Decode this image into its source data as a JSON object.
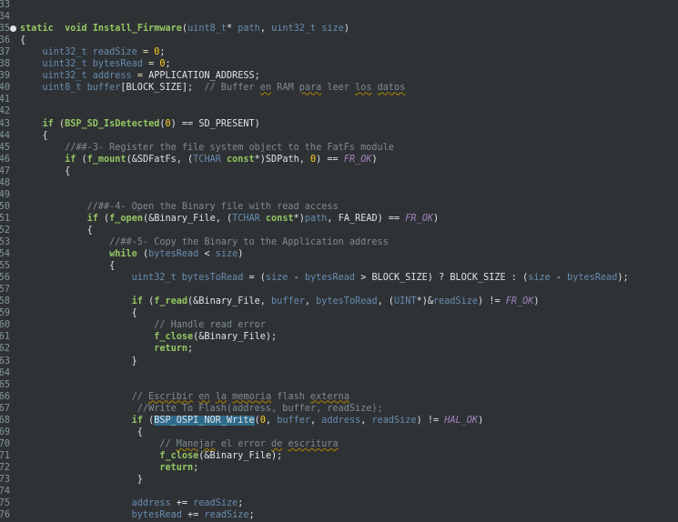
{
  "editor": {
    "lines": [
      {
        "n": "33",
        "segs": []
      },
      {
        "n": "34",
        "segs": []
      },
      {
        "n": "35",
        "bp": true,
        "segs": [
          [
            "kw",
            "static"
          ],
          [
            "",
            "  "
          ],
          [
            "kw",
            "void"
          ],
          [
            "",
            ""
          ],
          [
            "fndef",
            " Install_Firmware"
          ],
          [
            "",
            "("
          ],
          [
            "ty",
            "uint8_t"
          ],
          [
            "",
            "* "
          ],
          [
            "ty",
            "path"
          ],
          [
            "",
            ", "
          ],
          [
            "ty",
            "uint32_t"
          ],
          [
            "",
            ""
          ],
          [
            "ty",
            " size"
          ],
          [
            "",
            ")"
          ]
        ]
      },
      {
        "n": "36",
        "segs": [
          [
            "",
            "{"
          ]
        ]
      },
      {
        "n": "37",
        "segs": [
          [
            "",
            ""
          ],
          [
            "ty",
            "    uint32_t"
          ],
          [
            "ty",
            " readSize"
          ],
          [
            "op",
            " = "
          ],
          [
            "num",
            "0"
          ],
          [
            "",
            ";"
          ]
        ]
      },
      {
        "n": "38",
        "segs": [
          [
            "ty",
            "    uint32_t"
          ],
          [
            "ty",
            " bytesRead"
          ],
          [
            "op",
            " = "
          ],
          [
            "num",
            "0"
          ],
          [
            "",
            ";"
          ]
        ]
      },
      {
        "n": "39",
        "segs": [
          [
            "ty",
            "    uint32_t"
          ],
          [
            "ty",
            " address"
          ],
          [
            "op",
            " = "
          ],
          [
            "",
            "APPLICATION_ADDRESS;"
          ]
        ]
      },
      {
        "n": "40",
        "segs": [
          [
            "ty",
            "    uint8_t"
          ],
          [
            "ty",
            " buffer"
          ],
          [
            "",
            "[BLOCK_SIZE];  "
          ],
          [
            "cm",
            "// Buffer "
          ],
          [
            "sq",
            "en"
          ],
          [
            "cm",
            " RAM "
          ],
          [
            "sq",
            "para"
          ],
          [
            "cm",
            " leer "
          ],
          [
            "sq",
            "los"
          ],
          [
            "cm",
            " "
          ],
          [
            "sq",
            "datos"
          ]
        ]
      },
      {
        "n": "41",
        "segs": []
      },
      {
        "n": "42",
        "segs": []
      },
      {
        "n": "43",
        "segs": [
          [
            "kw",
            "    if"
          ],
          [
            "",
            ""
          ],
          [
            "op",
            " ("
          ],
          [
            "fn",
            "BSP_SD_IsDetected"
          ],
          [
            "",
            "("
          ],
          [
            "num",
            "0"
          ],
          [
            "",
            ") == SD_PRESENT)"
          ]
        ]
      },
      {
        "n": "44",
        "segs": [
          [
            "",
            "    {"
          ]
        ]
      },
      {
        "n": "45",
        "segs": [
          [
            "cm",
            "        //##-3- Register the file system object to the FatFs module"
          ]
        ]
      },
      {
        "n": "46",
        "segs": [
          [
            "kw",
            "        if"
          ],
          [
            "",
            " ("
          ],
          [
            "fn",
            "f_mount"
          ],
          [
            "",
            "(&SDFatFs, ("
          ],
          [
            "ty",
            "TCHAR"
          ],
          [
            "kw",
            " const"
          ],
          [
            "",
            "*)SDPath, "
          ],
          [
            "num",
            "0"
          ],
          [
            "",
            ") == "
          ],
          [
            "it",
            "FR_OK"
          ],
          [
            "",
            ")"
          ]
        ]
      },
      {
        "n": "47",
        "segs": [
          [
            "",
            "        {"
          ]
        ]
      },
      {
        "n": "48",
        "segs": []
      },
      {
        "n": "49",
        "segs": []
      },
      {
        "n": "50",
        "segs": [
          [
            "cm",
            "            //##-4- Open the Binary file with read access"
          ]
        ]
      },
      {
        "n": "51",
        "segs": [
          [
            "kw",
            "            if"
          ],
          [
            "",
            " ("
          ],
          [
            "fn",
            "f_open"
          ],
          [
            "",
            "(&Binary_File, ("
          ],
          [
            "ty",
            "TCHAR"
          ],
          [
            "kw",
            " const"
          ],
          [
            "",
            "*)"
          ],
          [
            "ty",
            "path"
          ],
          [
            "",
            ", FA_READ) == "
          ],
          [
            "it",
            "FR_OK"
          ],
          [
            "",
            ")"
          ]
        ]
      },
      {
        "n": "52",
        "segs": [
          [
            "",
            "            {"
          ]
        ]
      },
      {
        "n": "53",
        "segs": [
          [
            "cm",
            "                //##-5- Copy the Binary to the Application address"
          ]
        ]
      },
      {
        "n": "54",
        "segs": [
          [
            "kw",
            "                while"
          ],
          [
            "",
            " ("
          ],
          [
            "ty",
            "bytesRead"
          ],
          [
            "",
            " < "
          ],
          [
            "ty",
            "size"
          ],
          [
            "",
            ")"
          ]
        ]
      },
      {
        "n": "55",
        "segs": [
          [
            "",
            "                {"
          ]
        ]
      },
      {
        "n": "56",
        "segs": [
          [
            "ty",
            "                    uint32_t"
          ],
          [
            "ty",
            " bytesToRead"
          ],
          [
            "",
            " = ("
          ],
          [
            "ty",
            "size"
          ],
          [
            "",
            " - "
          ],
          [
            "ty",
            "bytesRead"
          ],
          [
            "",
            " > BLOCK_SIZE) ? BLOCK_SIZE : ("
          ],
          [
            "ty",
            "size"
          ],
          [
            "",
            " - "
          ],
          [
            "ty",
            "bytesRead"
          ],
          [
            "",
            ");"
          ]
        ]
      },
      {
        "n": "57",
        "segs": []
      },
      {
        "n": "58",
        "segs": [
          [
            "kw",
            "                    if"
          ],
          [
            "",
            " ("
          ],
          [
            "fn",
            "f_read"
          ],
          [
            "",
            "(&Binary_File, "
          ],
          [
            "ty",
            "buffer"
          ],
          [
            "",
            ", "
          ],
          [
            "ty",
            "bytesToRead"
          ],
          [
            "",
            ", ("
          ],
          [
            "ty",
            "UINT"
          ],
          [
            "",
            "*)&"
          ],
          [
            "ty",
            "readSize"
          ],
          [
            "",
            ") != "
          ],
          [
            "it",
            "FR_OK"
          ],
          [
            "",
            ")"
          ]
        ]
      },
      {
        "n": "59",
        "segs": [
          [
            "",
            "                    {"
          ]
        ]
      },
      {
        "n": "60",
        "segs": [
          [
            "cm",
            "                        // Handle read error"
          ]
        ]
      },
      {
        "n": "61",
        "segs": [
          [
            "fn",
            "                        f_close"
          ],
          [
            "",
            "(&Binary_File);"
          ]
        ]
      },
      {
        "n": "62",
        "segs": [
          [
            "kw",
            "                        return"
          ],
          [
            "",
            ";"
          ]
        ]
      },
      {
        "n": "63",
        "segs": [
          [
            "",
            "                    }"
          ]
        ]
      },
      {
        "n": "64",
        "segs": []
      },
      {
        "n": "65",
        "segs": []
      },
      {
        "n": "66",
        "segs": [
          [
            "cm",
            "                    // "
          ],
          [
            "sq",
            "Escribir"
          ],
          [
            "cm",
            " "
          ],
          [
            "sq",
            "en"
          ],
          [
            "cm",
            " "
          ],
          [
            "sq",
            "la"
          ],
          [
            "cm",
            " "
          ],
          [
            "sq",
            "memoria"
          ],
          [
            "cm",
            " flash "
          ],
          [
            "sq",
            "externa"
          ]
        ]
      },
      {
        "n": "67",
        "segs": [
          [
            "cm",
            "                     //Write To Flash(address, buffer, readSize);"
          ]
        ]
      },
      {
        "n": "68",
        "segs": [
          [
            "kw",
            "                    if"
          ],
          [
            "",
            " ("
          ],
          [
            "hl",
            "BSP_OSPI_NOR_Write"
          ],
          [
            "",
            "("
          ],
          [
            "num",
            "0"
          ],
          [
            "",
            ", "
          ],
          [
            "ty",
            "buffer"
          ],
          [
            "",
            ", "
          ],
          [
            "ty",
            "address"
          ],
          [
            "",
            ", "
          ],
          [
            "ty",
            "readSize"
          ],
          [
            "",
            ") != "
          ],
          [
            "it",
            "HAL_OK"
          ],
          [
            "",
            ")"
          ]
        ]
      },
      {
        "n": "69",
        "segs": [
          [
            "",
            "                     {"
          ]
        ]
      },
      {
        "n": "70",
        "segs": [
          [
            "cm",
            "                         // "
          ],
          [
            "sq",
            "Manejar"
          ],
          [
            "cm",
            " el error "
          ],
          [
            "sq",
            "de"
          ],
          [
            "cm",
            " "
          ],
          [
            "sq",
            "escritura"
          ]
        ]
      },
      {
        "n": "71",
        "segs": [
          [
            "fn",
            "                         f_close"
          ],
          [
            "",
            "(&Binary_File);"
          ]
        ]
      },
      {
        "n": "72",
        "segs": [
          [
            "kw",
            "                         return"
          ],
          [
            "",
            ";"
          ]
        ]
      },
      {
        "n": "73",
        "segs": [
          [
            "",
            "                     }"
          ]
        ]
      },
      {
        "n": "74",
        "segs": []
      },
      {
        "n": "75",
        "segs": [
          [
            "ty",
            "                    address"
          ],
          [
            "",
            " += "
          ],
          [
            "ty",
            "readSize"
          ],
          [
            "",
            ";"
          ]
        ]
      },
      {
        "n": "76",
        "segs": [
          [
            "ty",
            "                    bytesRead"
          ],
          [
            "",
            " += "
          ],
          [
            "ty",
            "readSize"
          ],
          [
            "",
            ";"
          ]
        ]
      }
    ]
  }
}
